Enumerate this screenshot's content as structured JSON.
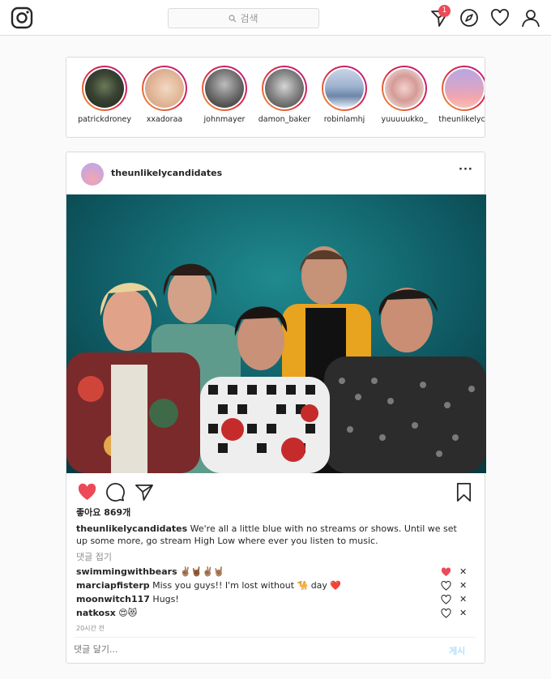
{
  "nav": {
    "search_placeholder": "검색",
    "notification_count": "1"
  },
  "stories": [
    {
      "name": "patrickdroney"
    },
    {
      "name": "xxadoraa"
    },
    {
      "name": "johnmayer"
    },
    {
      "name": "damon_baker"
    },
    {
      "name": "robinlamhj"
    },
    {
      "name": "yuuuuukko_"
    },
    {
      "name": "theunlikelyca"
    }
  ],
  "post": {
    "username": "theunlikelycandidates",
    "more": "···",
    "likes": "좋아요 869개",
    "caption_user": "theunlikelycandidates",
    "caption_text": " We're all a little blue with no streams or shows. Until we set up some more, go stream High Low where ever you listen to music.",
    "collapse_label": "댓글 접기",
    "comments": [
      {
        "user": "swimmingwithbears",
        "text": " ✌🏽🤘🏾✌🏽🤘🏽",
        "liked": true
      },
      {
        "user": "marciapfisterp",
        "text": " Miss you guys!! I'm lost without 🐪 day ❤️",
        "liked": false
      },
      {
        "user": "moonwitch117",
        "text": " Hugs!",
        "liked": false
      },
      {
        "user": "natkosx",
        "text": " 😍😻",
        "liked": false
      }
    ],
    "time_ago": "20시간 전",
    "comment_placeholder": "댓글 달기...",
    "post_button": "게시"
  },
  "colors": {
    "like_red": "#ed4956",
    "post_button_blue": "#b2dffc"
  }
}
